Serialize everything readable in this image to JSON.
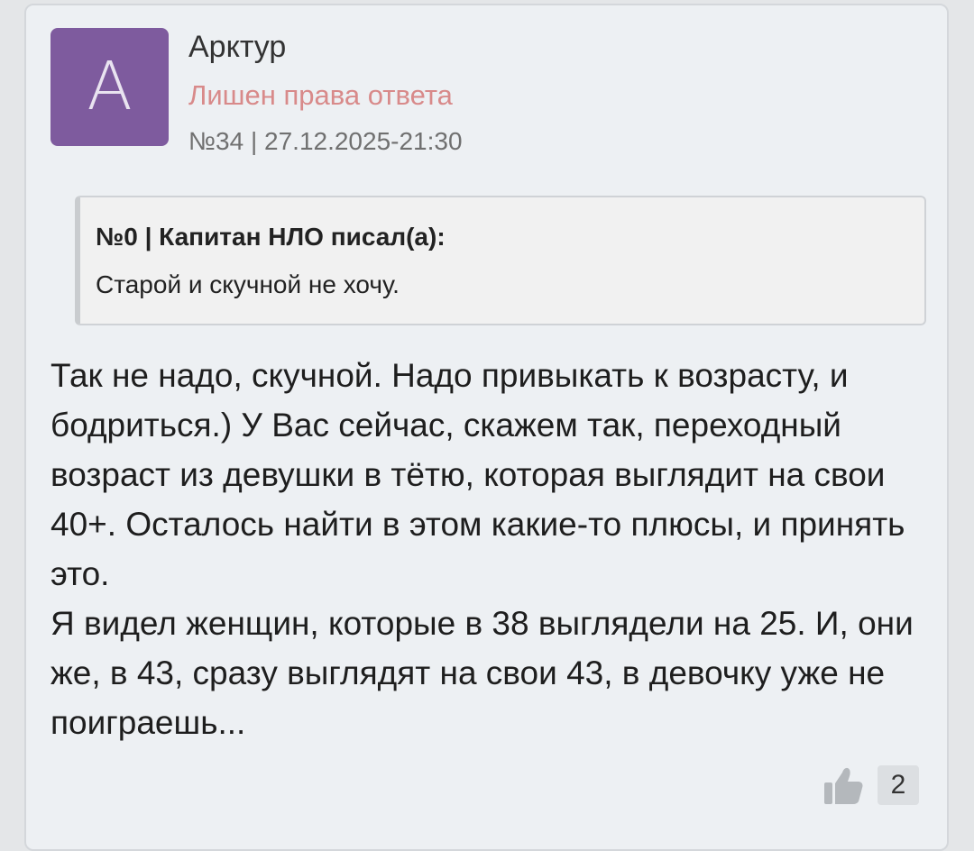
{
  "post": {
    "avatar_letter": "A",
    "author": "Арктур",
    "status": "Лишен права ответа",
    "meta": "№34 | 27.12.2025-21:30",
    "quote": {
      "title": "№0 | Капитан НЛО писал(а):",
      "text": "Старой и скучной не хочу."
    },
    "body": {
      "paragraph1": "Так не надо, скучной. Надо привыкать к возрасту, и бодриться.) У Вас сейчас, скажем так, переходный возраст из девушки в тётю, которая выглядит на свои 40+. Осталось найти в этом какие-то плюсы, и принять это.",
      "paragraph2": "Я видел женщин, которые в 38 выглядели на 25. И, они же, в 43, сразу выглядят на свои 43, в девочку уже не поиграешь..."
    },
    "likes": {
      "icon": "thumbs-up-icon",
      "count": "2"
    }
  },
  "colors": {
    "avatar_bg": "#7e5b9e",
    "status": "#d88a8a",
    "card_bg": "#edf0f3"
  }
}
